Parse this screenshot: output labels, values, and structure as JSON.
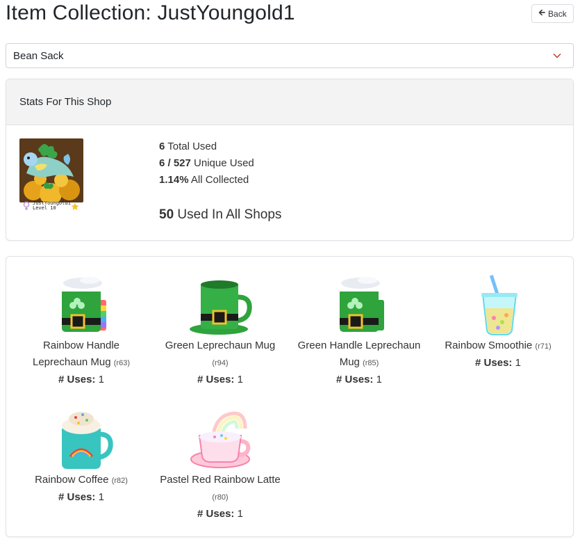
{
  "header": {
    "title": "Item Collection: JustYoungold1",
    "back_label": "Back"
  },
  "shop_select": {
    "selected": "Bean Sack"
  },
  "stats": {
    "header": "Stats For This Shop",
    "user": {
      "name": "JustYoungold1",
      "level": "Level 10"
    },
    "total_used_value": "6",
    "total_used_label": "Total Used",
    "unique_used_value": "6 / 527",
    "unique_used_label": "Unique Used",
    "all_collected_value": "1.14%",
    "all_collected_label": "All Collected",
    "all_shops_value": "50",
    "all_shops_label": "Used In All Shops"
  },
  "items": [
    {
      "name": "Rainbow Handle Leprechaun Mug",
      "rarity": "(r63)",
      "uses_label": "# Uses:",
      "uses": "1",
      "icon": "rainbow-handle-leprechaun-mug-icon"
    },
    {
      "name": "Green Leprechaun Mug",
      "rarity": "(r94)",
      "uses_label": "# Uses:",
      "uses": "1",
      "icon": "green-leprechaun-mug-icon"
    },
    {
      "name": "Green Handle Leprechaun Mug",
      "rarity": "(r85)",
      "uses_label": "# Uses:",
      "uses": "1",
      "icon": "green-handle-leprechaun-mug-icon"
    },
    {
      "name": "Rainbow Smoothie",
      "rarity": "(r71)",
      "uses_label": "# Uses:",
      "uses": "1",
      "icon": "rainbow-smoothie-icon"
    },
    {
      "name": "Rainbow Coffee",
      "rarity": "(r82)",
      "uses_label": "# Uses:",
      "uses": "1",
      "icon": "rainbow-coffee-icon"
    },
    {
      "name": "Pastel Red Rainbow Latte",
      "rarity": "(r80)",
      "uses_label": "# Uses:",
      "uses": "1",
      "icon": "pastel-red-rainbow-latte-icon"
    }
  ],
  "colors": {
    "text": "#212529",
    "border": "#dfe2e6",
    "card_header_bg": "#f3f3f3",
    "chevron": "#c0392b"
  }
}
